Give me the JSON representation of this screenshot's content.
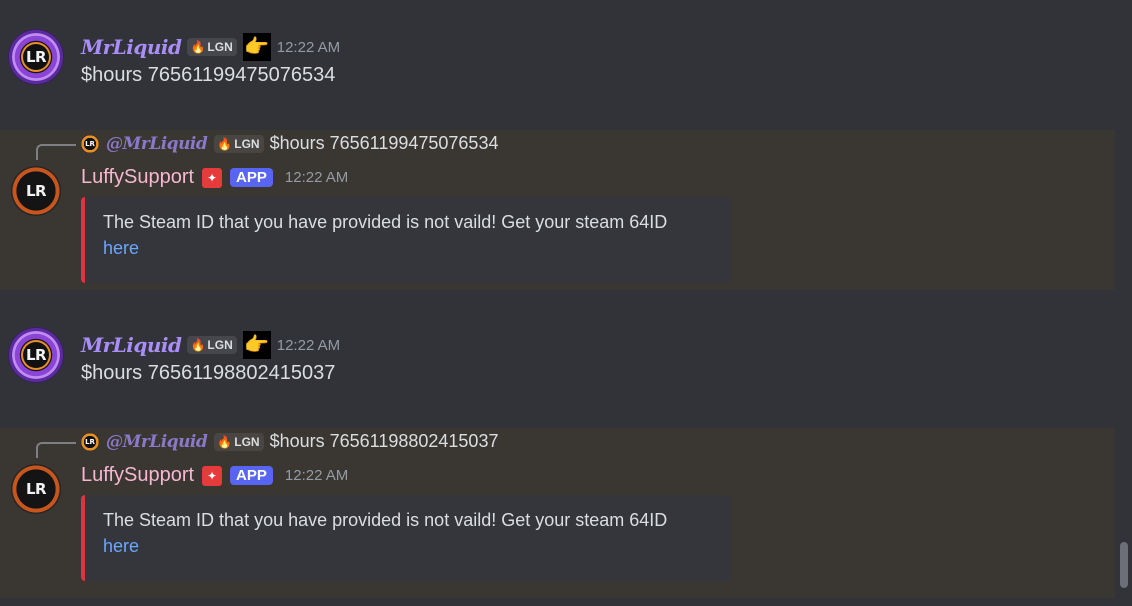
{
  "messages": [
    {
      "author": "MrLiquid",
      "tag": "LGN",
      "time": "12:22 AM",
      "text": "$hours 76561199475076534"
    },
    {
      "reply_to": {
        "author": "@MrLiquid",
        "tag": "LGN",
        "text": "$hours 76561199475076534"
      },
      "author": "LuffySupport",
      "badge": "APP",
      "time": "12:22 AM",
      "embed": {
        "text": "The Steam ID that you have provided is not vaild! Get your steam 64ID",
        "link": "here",
        "accent": "#da373c"
      }
    },
    {
      "author": "MrLiquid",
      "tag": "LGN",
      "time": "12:22 AM",
      "text": "$hours 76561198802415037"
    },
    {
      "reply_to": {
        "author": "@MrLiquid",
        "tag": "LGN",
        "text": "$hours 76561198802415037"
      },
      "author": "LuffySupport",
      "badge": "APP",
      "time": "12:22 AM",
      "embed": {
        "text": "The Steam ID that you have provided is not vaild! Get your steam 64ID",
        "link": "here",
        "accent": "#da373c"
      }
    }
  ],
  "avatar_text": "LR",
  "icons": {
    "hand": "pointing-hand-icon",
    "flame": "flame-icon",
    "verified": "bot-verified-icon"
  },
  "colors": {
    "background": "#313338",
    "mention_highlight": "#3a3632",
    "username": "#a98ef8",
    "botname": "#f7b7d2",
    "app_badge": "#5865f2",
    "link": "#6ba6ff"
  }
}
